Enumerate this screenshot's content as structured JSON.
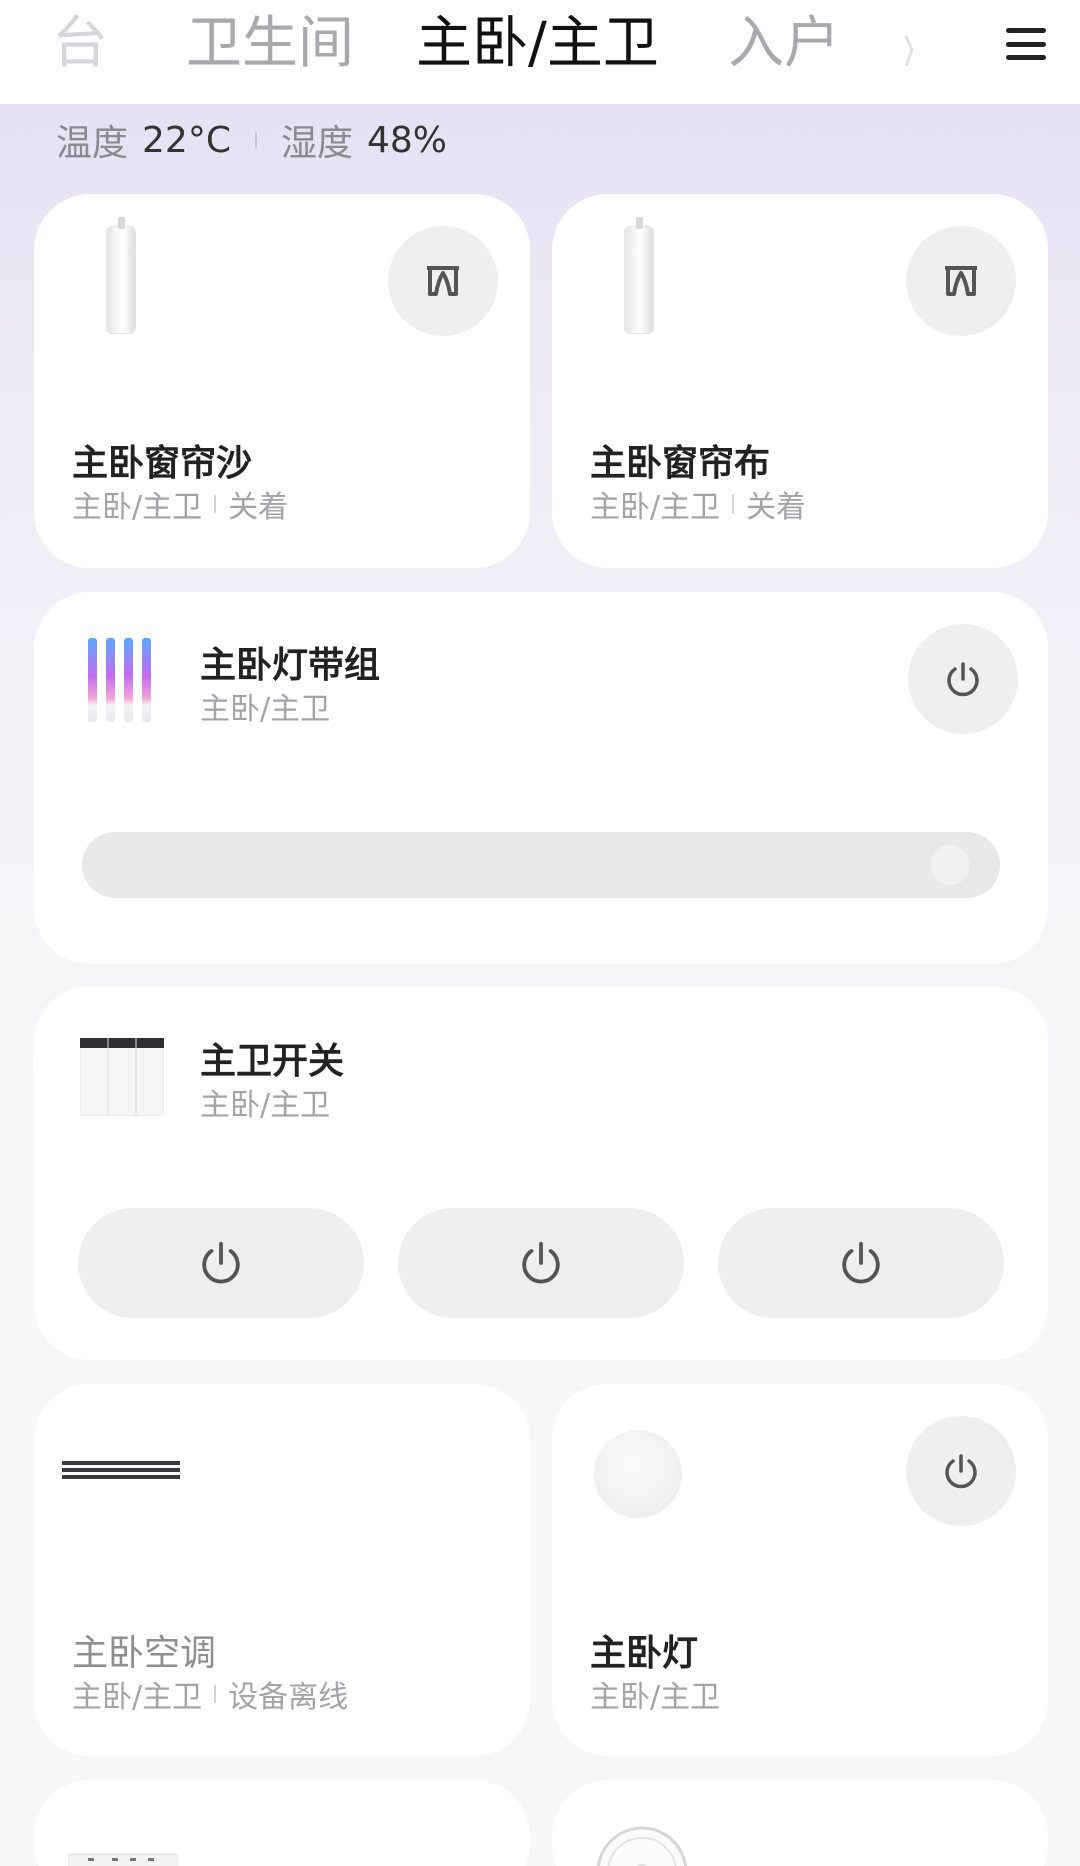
{
  "tabs": [
    {
      "label": "台",
      "state": "partial"
    },
    {
      "label": "卫生间",
      "state": "normal"
    },
    {
      "label": "主卧/主卫",
      "state": "active"
    },
    {
      "label": "入户",
      "state": "normal"
    }
  ],
  "climate": {
    "temp_label": "温度",
    "temp_value": "22°C",
    "humidity_label": "湿度",
    "humidity_value": "48%"
  },
  "devices": {
    "curtain_sha": {
      "name": "主卧窗帘沙",
      "room": "主卧/主卫",
      "status": "关着",
      "icon": "curtain-icon"
    },
    "curtain_bu": {
      "name": "主卧窗帘布",
      "room": "主卧/主卫",
      "status": "关着",
      "icon": "curtain-icon"
    },
    "light_strip": {
      "name": "主卧灯带组",
      "room": "主卧/主卫",
      "brightness": 0.98
    },
    "switch": {
      "name": "主卫开关",
      "room": "主卧/主卫",
      "channels": 3
    },
    "ac": {
      "name": "主卧空调",
      "room": "主卧/主卫",
      "status": "设备离线"
    },
    "light": {
      "name": "主卧灯",
      "room": "主卧/主卫"
    }
  },
  "colors": {
    "accent_gradient_top": "#e2dcf2",
    "card_bg": "#ffffff",
    "button_bg": "#efefef"
  }
}
